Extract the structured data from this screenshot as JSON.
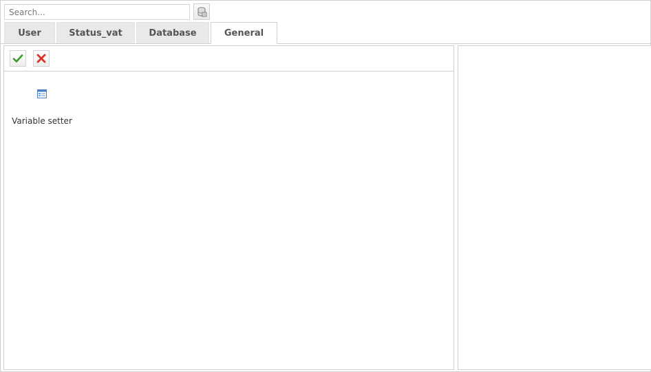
{
  "search": {
    "placeholder": "Search...",
    "button_icon": "database-search-icon"
  },
  "tabs": [
    {
      "label": "User",
      "active": false
    },
    {
      "label": "Status_vat",
      "active": false
    },
    {
      "label": "Database",
      "active": false
    },
    {
      "label": "General",
      "active": true
    }
  ],
  "toolbar": {
    "ok_icon": "checkmark-icon",
    "cancel_icon": "close-icon"
  },
  "items": [
    {
      "label": "Variable setter",
      "icon": "form-window-icon"
    }
  ],
  "colors": {
    "tab_inactive_bg": "#e9e9e9",
    "border": "#cfcfcf",
    "ok_green": "#3a9a2a",
    "cancel_red": "#d9322a"
  }
}
